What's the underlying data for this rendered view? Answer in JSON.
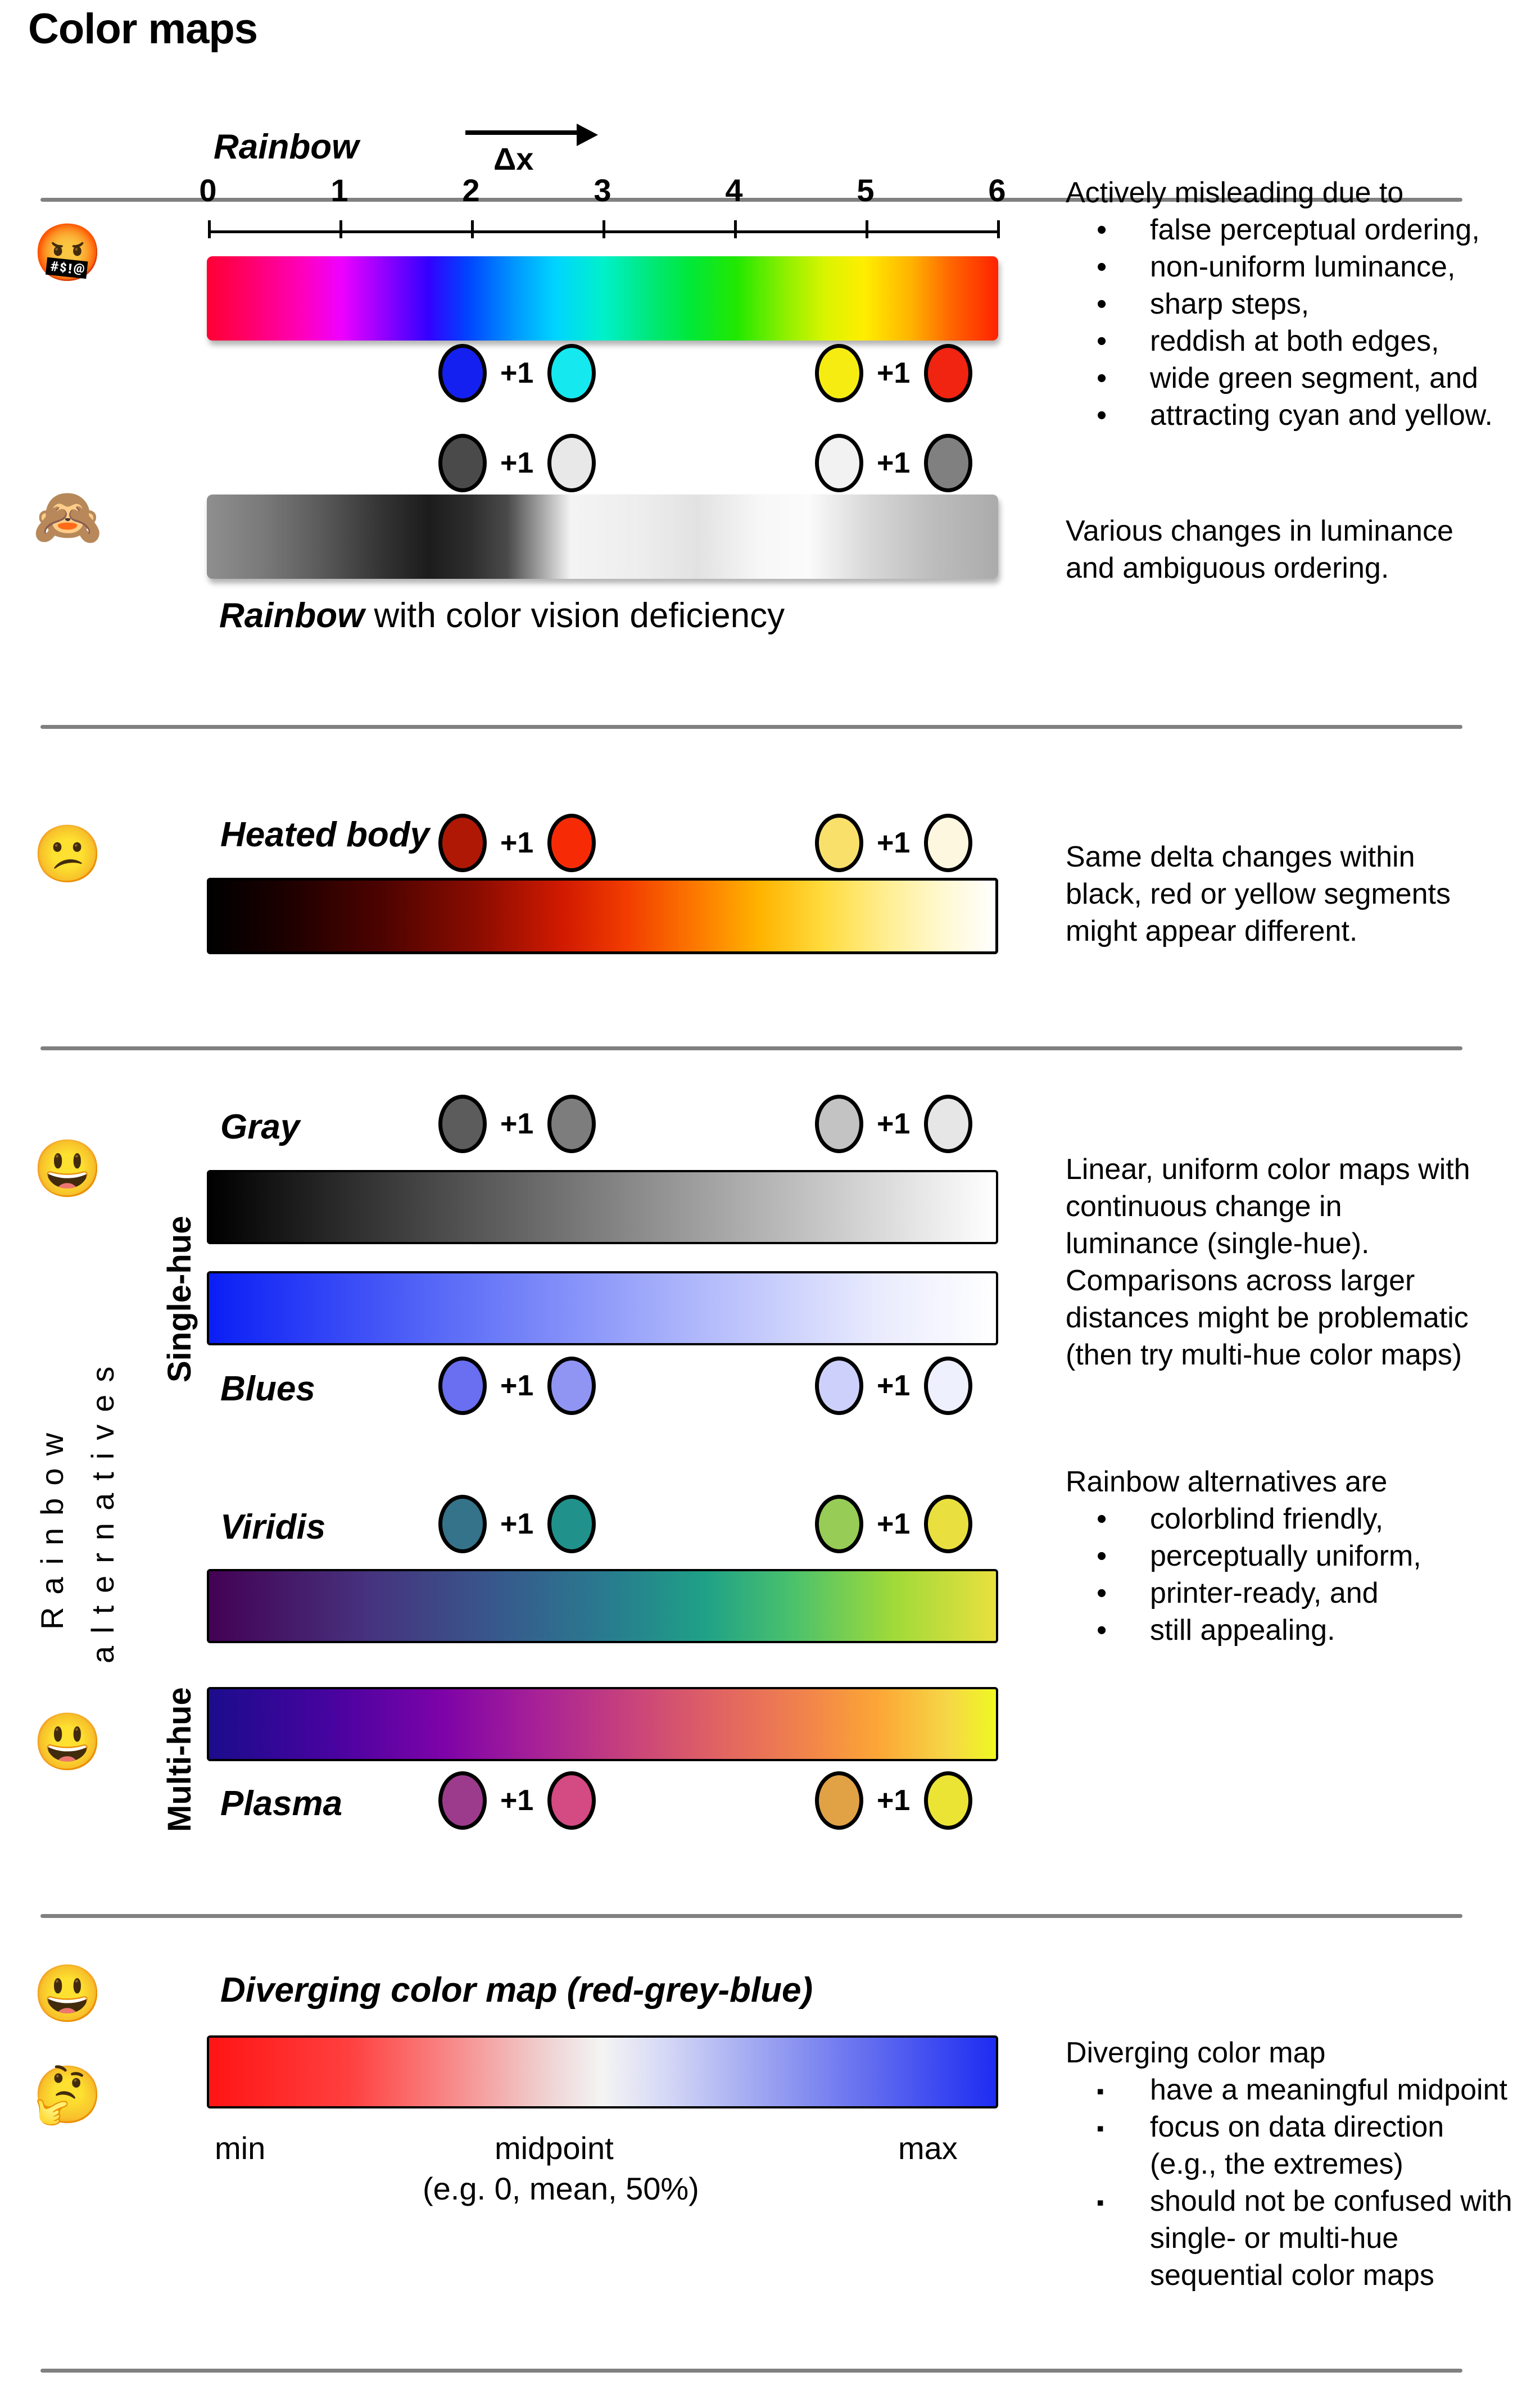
{
  "title": "Color maps",
  "section_rainbow": {
    "cmap_label": "Rainbow",
    "dx_label": "Δx",
    "ticks": [
      "0",
      "1",
      "2",
      "3",
      "4",
      "5",
      "6"
    ],
    "cvd_caption_italic": "Rainbow",
    "cvd_caption_rest": " with color vision deficiency",
    "emoji_angry": "🤬",
    "emoji_monkey": "🙈",
    "plus_label": "+1",
    "swatch_rows": [
      {
        "name": "rainbow-color-swatches",
        "dots": [
          "#1420f0",
          "#16e8f0",
          "#f7ec12",
          "#f02410"
        ]
      },
      {
        "name": "rainbow-cvd-swatches",
        "dots": [
          "#4a4a4a",
          "#e8e8e8",
          "#f2f2f2",
          "#808080"
        ]
      }
    ],
    "notes_heading": "Actively misleading due to",
    "notes_bullets": [
      "false perceptual ordering,",
      "non-uniform luminance,",
      "sharp steps,",
      "reddish at both edges,",
      "wide green segment, and",
      "attracting cyan and yellow."
    ],
    "cvd_note_lines": [
      "Various changes in luminance",
      "and ambiguous ordering."
    ]
  },
  "section_heated": {
    "cmap_label": "Heated body",
    "emoji": "😕",
    "plus_label": "+1",
    "dots": [
      "#b01806",
      "#f62b06",
      "#f8e06a",
      "#fdf7e0"
    ],
    "note_lines": [
      "Same delta changes within",
      "black, red or yellow segments",
      "might appear different."
    ]
  },
  "section_alternatives": {
    "vertical_label_line1": "Rainbow",
    "vertical_label_line2": "alternatives",
    "group_single_hue": "Single-hue",
    "group_multi_hue": "Multi-hue",
    "emoji_top": "😃",
    "emoji_bottom": "😃",
    "plus_label": "+1",
    "maps": [
      {
        "name": "Gray",
        "dots": [
          "#5c5c5c",
          "#7d7d7d",
          "#c3c3c3",
          "#e6e6e6"
        ]
      },
      {
        "name": "Blues",
        "dots": [
          "#6a6ef0",
          "#9094f2",
          "#ccd0fa",
          "#eef0fd"
        ]
      },
      {
        "name": "Viridis",
        "dots": [
          "#35738a",
          "#21918c",
          "#97cc56",
          "#e9e03f"
        ]
      },
      {
        "name": "Plasma",
        "dots": [
          "#9c3b8c",
          "#d44a82",
          "#e0a245",
          "#ece435"
        ]
      }
    ],
    "note_single_lines": [
      "Linear, uniform color maps with",
      "continuous change in",
      "luminance (single-hue).",
      "Comparisons across larger",
      "distances might be problematic",
      "(then try multi-hue color maps)"
    ],
    "notes_heading": "Rainbow alternatives are",
    "notes_bullets": [
      "colorblind friendly,",
      "perceptually uniform,",
      "printer-ready, and",
      "still appealing."
    ]
  },
  "section_diverging": {
    "cmap_label": "Diverging color map (red-grey-blue)",
    "emoji_top": "😃",
    "emoji_bottom": "🤔",
    "min_label": "min",
    "mid_label": "midpoint",
    "mid_sub_label": "(e.g. 0, mean, 50%)",
    "max_label": "max",
    "notes_heading": "Diverging color map",
    "notes_bullets": [
      "have a meaningful midpoint",
      "focus on data direction",
      "(e.g., the extremes)",
      "should not be confused with",
      "single- or multi-hue",
      "sequential color maps"
    ]
  },
  "bullet_glyph_round": "•",
  "bullet_glyph_square": "▪",
  "chart_data": {
    "type": "heatmap",
    "title": "Color maps",
    "colormaps": [
      {
        "name": "Rainbow",
        "category": "rainbow",
        "axis_ticks": [
          0,
          1,
          2,
          3,
          4,
          5,
          6
        ],
        "stops": [
          "#ff0033",
          "#ff00cc",
          "#cc00ff",
          "#2200ff",
          "#0088ff",
          "#00eedd",
          "#00e47a",
          "#1fe800",
          "#b6f200",
          "#ffee00",
          "#ff8800",
          "#ff2200"
        ]
      },
      {
        "name": "Rainbow with color vision deficiency",
        "category": "rainbow-cvd",
        "stops": [
          "#8c8c8c",
          "#6e6e6e",
          "#2b2b2b",
          "#1a1a1a",
          "#4a4a4a",
          "#f2f2f2",
          "#e0e0e0",
          "#d8d8d8",
          "#f4f4f4",
          "#c8c8c8",
          "#b4b4b4"
        ]
      },
      {
        "name": "Heated body",
        "category": "sequential-multi-hue",
        "stops": [
          "#000000",
          "#3b0000",
          "#8c0f00",
          "#e52200",
          "#ff6a00",
          "#ffc400",
          "#ffe96b",
          "#ffffff"
        ]
      },
      {
        "name": "Gray",
        "category": "sequential-single-hue",
        "stops": [
          "#000000",
          "#ffffff"
        ]
      },
      {
        "name": "Blues",
        "category": "sequential-single-hue",
        "stops": [
          "#0a1ef5",
          "#ffffff"
        ]
      },
      {
        "name": "Viridis",
        "category": "sequential-multi-hue",
        "stops": [
          "#440154",
          "#3b528b",
          "#21918c",
          "#5ec962",
          "#fde725"
        ]
      },
      {
        "name": "Plasma",
        "category": "sequential-multi-hue",
        "stops": [
          "#0d0887",
          "#6a00a8",
          "#b12a90",
          "#e16462",
          "#fca636",
          "#f0f921"
        ]
      },
      {
        "name": "Diverging color map (red-grey-blue)",
        "category": "diverging",
        "stops": [
          "#ff1111",
          "#ffffff",
          "#1111ff"
        ]
      }
    ]
  }
}
